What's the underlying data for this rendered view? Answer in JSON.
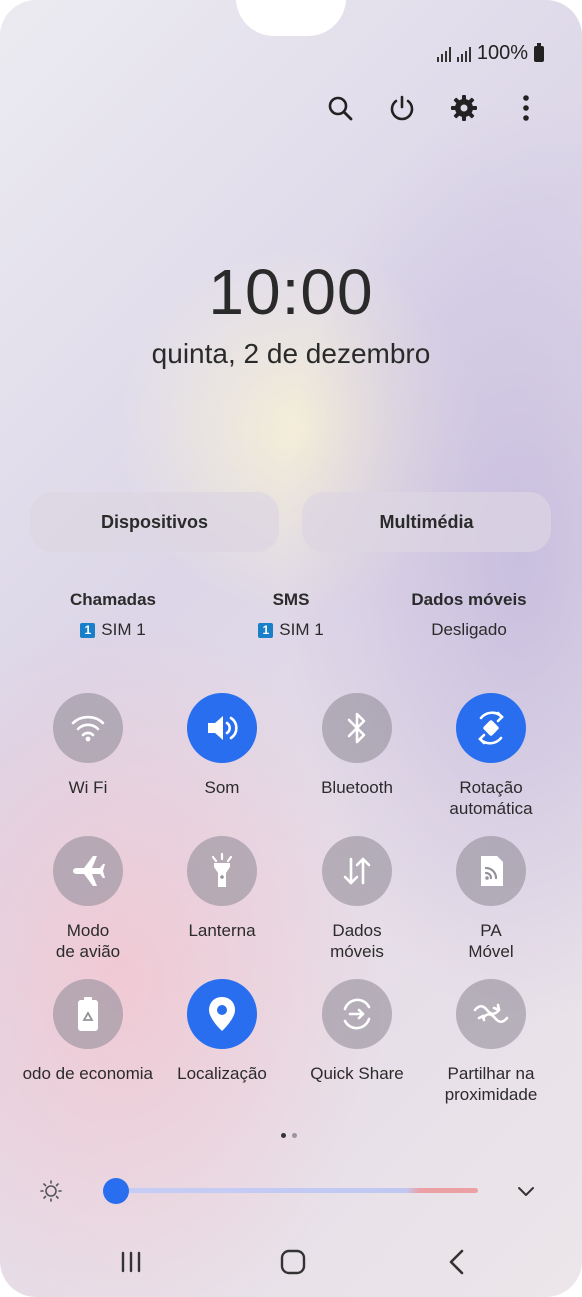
{
  "status": {
    "battery_text": "100%"
  },
  "toolbar": {
    "icons": [
      "search-icon",
      "power-icon",
      "gear-icon",
      "more-vertical-icon"
    ]
  },
  "clock": {
    "time": "10:00",
    "date": "quinta, 2 de dezembro"
  },
  "buttons": {
    "devices": "Dispositivos",
    "media": "Multimédia"
  },
  "sim_info": [
    {
      "title": "Chamadas",
      "value": "SIM 1",
      "badge": "1"
    },
    {
      "title": "SMS",
      "value": "SIM 1",
      "badge": "1"
    },
    {
      "title": "Dados móveis",
      "value": "Desligado"
    }
  ],
  "tiles": [
    {
      "label": "Wi Fi",
      "icon": "wifi-icon",
      "active": false
    },
    {
      "label": "Som",
      "icon": "volume-icon",
      "active": true
    },
    {
      "label": "Bluetooth",
      "icon": "bluetooth-icon",
      "active": false
    },
    {
      "label": "Rotação\nautomática",
      "icon": "auto-rotate-icon",
      "active": true
    },
    {
      "label": "Modo\nde avião",
      "icon": "airplane-icon",
      "active": false
    },
    {
      "label": "Lanterna",
      "icon": "flashlight-icon",
      "active": false
    },
    {
      "label": "Dados\nmóveis",
      "icon": "mobile-data-icon",
      "active": false
    },
    {
      "label": "PA\nMóvel",
      "icon": "hotspot-icon",
      "active": false
    },
    {
      "label": "Modo de economia",
      "icon": "power-saving-icon",
      "active": false
    },
    {
      "label": "Localização",
      "icon": "location-icon",
      "active": true
    },
    {
      "label": "Quick Share",
      "icon": "quick-share-icon",
      "active": false
    },
    {
      "label": "Partilhar na\nproximidade",
      "icon": "nearby-share-icon",
      "active": false
    }
  ],
  "pager": {
    "pages": 2,
    "current": 1
  },
  "brightness": {
    "level": 0.0
  },
  "colors": {
    "accent": "#2a6ef0",
    "tile_off": "#96929c",
    "text": "#2b2b2b"
  }
}
